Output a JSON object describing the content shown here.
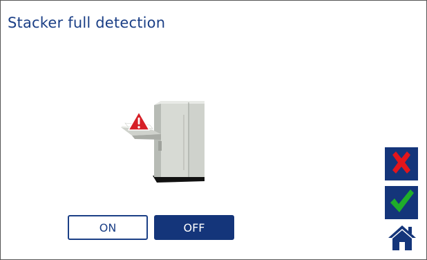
{
  "screen": {
    "title": "Stacker full detection"
  },
  "illustration": {
    "icon": "stacker-machine-with-warning"
  },
  "toggle": {
    "on_label": "ON",
    "off_label": "OFF",
    "selected": "OFF"
  },
  "actions": {
    "cancel_icon": "close-icon",
    "confirm_icon": "checkmark-icon",
    "home_icon": "home-icon"
  },
  "colors": {
    "brand_blue": "#14357a",
    "title_blue": "#1b3f86",
    "cancel_red": "#e3151b",
    "confirm_green": "#1fae2a",
    "warning_red": "#d62027"
  }
}
